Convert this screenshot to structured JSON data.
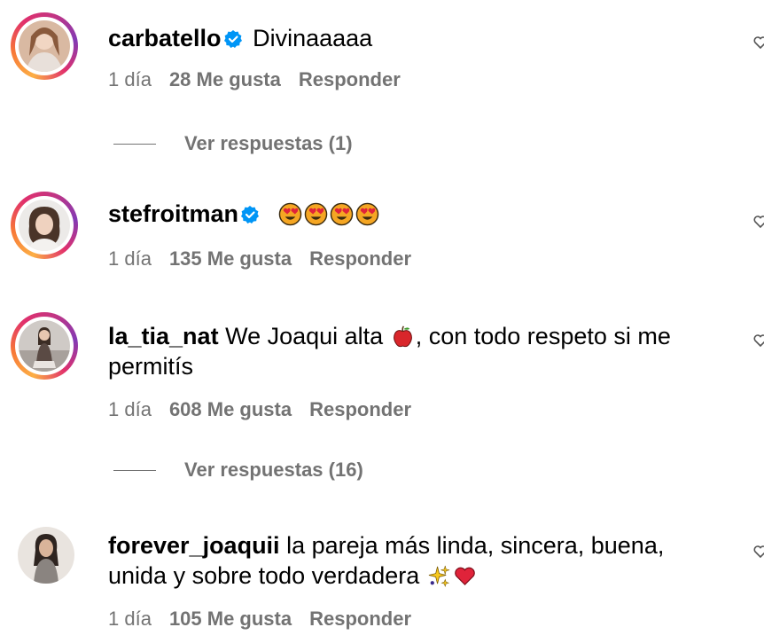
{
  "comments": [
    {
      "username": "carbatello",
      "verified": true,
      "text": "Divinaaaaa",
      "time": "1 día",
      "likes": "28 Me gusta",
      "reply": "Responder",
      "view_replies": "Ver respuestas (1)"
    },
    {
      "username": "stefroitman",
      "verified": true,
      "text": "",
      "emojis": [
        "heart-eyes-emoji",
        "heart-eyes-emoji",
        "heart-eyes-emoji",
        "heart-eyes-emoji"
      ],
      "time": "1 día",
      "likes": "135 Me gusta",
      "reply": "Responder"
    },
    {
      "username": "la_tia_nat",
      "verified": false,
      "text_before": "We Joaqui alta",
      "emoji": "apple-emoji",
      "text_after": ", con todo respeto si me permitís",
      "time": "1 día",
      "likes": "608 Me gusta",
      "reply": "Responder",
      "view_replies": "Ver respuestas (16)"
    },
    {
      "username": "forever_joaquii",
      "verified": false,
      "text": "la pareja más linda, sincera, buena, unida y sobre todo verdadera",
      "emojis": [
        "sparkles-emoji",
        "red-heart-emoji"
      ],
      "time": "1 día",
      "likes": "105 Me gusta",
      "reply": "Responder"
    }
  ],
  "colors": {
    "meta_text": "#737373",
    "verified_blue": "#0095f6",
    "story_ring": [
      "#fcaf45",
      "#e1306c",
      "#833ab4"
    ]
  }
}
